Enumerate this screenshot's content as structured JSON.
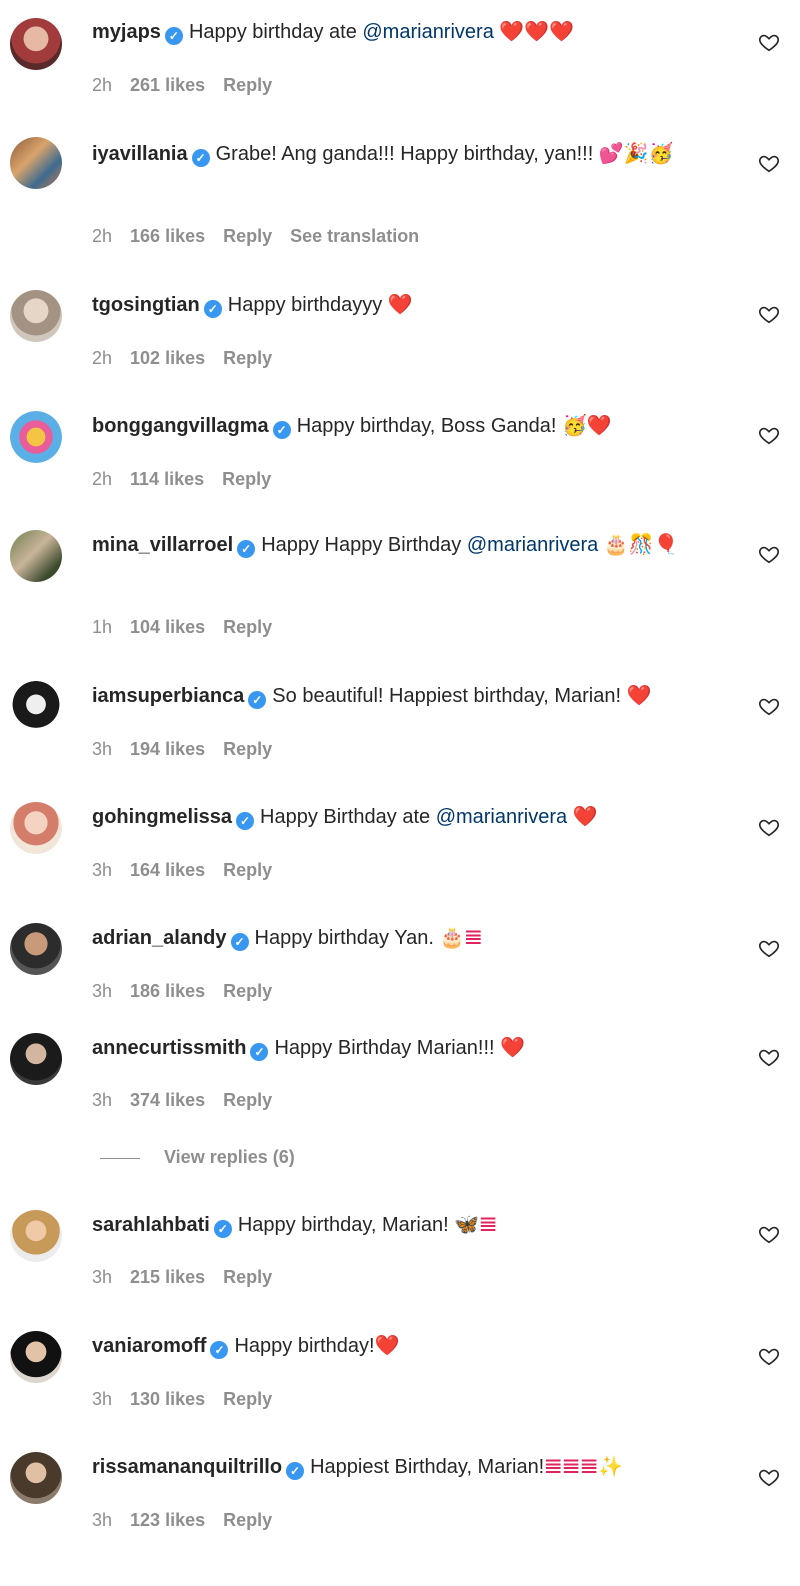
{
  "comments": [
    {
      "user": "myjaps",
      "text": "Happy birthday ate ",
      "mention": "@marianrivera",
      "emoji": " ❤️❤️❤️",
      "time": "2h",
      "likes": "261 likes",
      "reply": "Reply",
      "translate": ""
    },
    {
      "user": "iyavillania",
      "text": "Grabe! Ang ganda!!! Happy birthday, yan!!! ",
      "mention": "",
      "emoji": "💕🎉🥳",
      "time": "2h",
      "likes": "166 likes",
      "reply": "Reply",
      "translate": "See translation"
    },
    {
      "user": "tgosingtian",
      "text": "Happy birthdayyy ",
      "mention": "",
      "emoji": "❤️",
      "time": "2h",
      "likes": "102 likes",
      "reply": "Reply",
      "translate": ""
    },
    {
      "user": "bonggangvillagma",
      "text": "Happy birthday, Boss Ganda! ",
      "mention": "",
      "emoji": "🥳❤️",
      "time": "2h",
      "likes": "114 likes",
      "reply": "Reply",
      "translate": ""
    },
    {
      "user": "mina_villarroel",
      "text": "Happy Happy Birthday ",
      "mention": "@marianrivera",
      "emoji": " 🎂🎊🎈",
      "time": "1h",
      "likes": "104 likes",
      "reply": "Reply",
      "translate": ""
    },
    {
      "user": "iamsuperbianca",
      "text": "So beautiful! Happiest birthday, Marian! ",
      "mention": "",
      "emoji": "❤️",
      "time": "3h",
      "likes": "194 likes",
      "reply": "Reply",
      "translate": ""
    },
    {
      "user": "gohingmelissa",
      "text": "Happy Birthday ate ",
      "mention": "@marianrivera",
      "emoji": " ❤️",
      "time": "3h",
      "likes": "164 likes",
      "reply": "Reply",
      "translate": ""
    },
    {
      "user": "adrian_alandy",
      "text": "Happy birthday Yan. ",
      "mention": "",
      "emoji": "🎂𝌆",
      "time": "3h",
      "likes": "186 likes",
      "reply": "Reply",
      "translate": ""
    },
    {
      "user": "annecurtissmith",
      "text": "Happy Birthday Marian!!! ",
      "mention": "",
      "emoji": "❤️",
      "time": "3h",
      "likes": "374 likes",
      "reply": "Reply",
      "translate": ""
    },
    {
      "user": "sarahlahbati",
      "text": "Happy birthday, Marian! ",
      "mention": "",
      "emoji": "🦋𝌆",
      "time": "3h",
      "likes": "215 likes",
      "reply": "Reply",
      "translate": ""
    },
    {
      "user": "vaniaromoff",
      "text": "Happy birthday!",
      "mention": "",
      "emoji": "❤️",
      "time": "3h",
      "likes": "130 likes",
      "reply": "Reply",
      "translate": ""
    },
    {
      "user": "rissamananquiltrillo",
      "text": "Happiest Birthday, Marian!",
      "mention": "",
      "emoji": "𝌆𝌆𝌆✨",
      "time": "3h",
      "likes": "123 likes",
      "reply": "Reply",
      "translate": ""
    }
  ],
  "view_replies": "View replies (6)",
  "icons": {
    "verified": "verified-badge-icon",
    "like": "heart-outline-icon"
  },
  "colors": {
    "verified": "#3897f0",
    "mention": "#00376b",
    "meta": "#8e8e8e"
  }
}
